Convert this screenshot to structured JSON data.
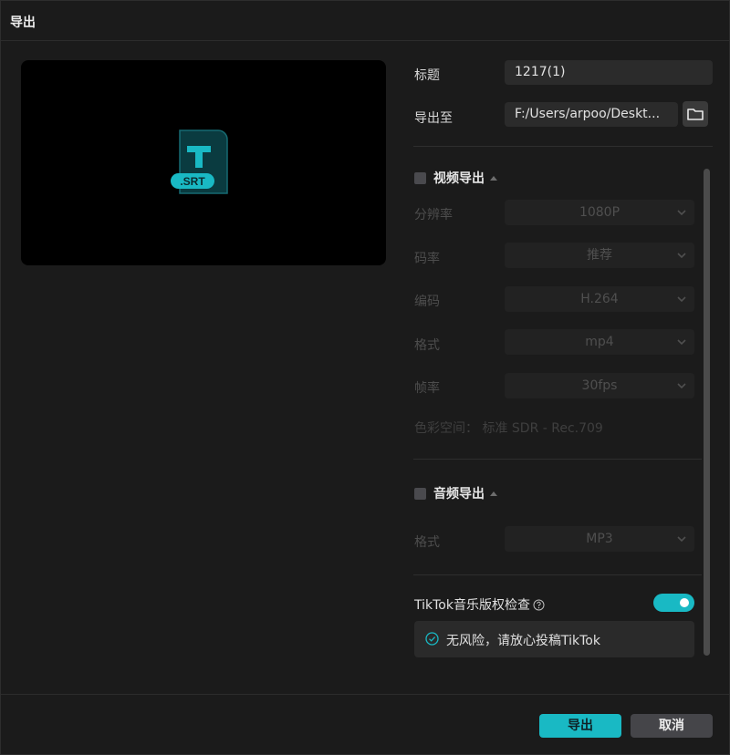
{
  "window": {
    "title": "导出"
  },
  "preview": {
    "file_badge": ".SRT",
    "icon_letter": "T"
  },
  "form": {
    "title_label": "标题",
    "title_value": "1217(1)",
    "export_to_label": "导出至",
    "export_to_value": "F:/Users/arpoo/Deskt..."
  },
  "video_export": {
    "title": "视频导出",
    "checked": false,
    "rows": [
      {
        "label": "分辨率",
        "value": "1080P"
      },
      {
        "label": "码率",
        "value": "推荐"
      },
      {
        "label": "编码",
        "value": "H.264"
      },
      {
        "label": "格式",
        "value": "mp4"
      },
      {
        "label": "帧率",
        "value": "30fps"
      }
    ],
    "color_space": "色彩空间：  标准 SDR - Rec.709"
  },
  "audio_export": {
    "title": "音频导出",
    "checked": false,
    "format_label": "格式",
    "format_value": "MP3"
  },
  "tiktok_check": {
    "label": "TikTok音乐版权检查",
    "enabled": true,
    "result": "无风险，请放心投稿TikTok"
  },
  "buttons": {
    "export": "导出",
    "cancel": "取消"
  },
  "colors": {
    "accent": "#19b9c4",
    "background": "#1b1b1b",
    "field": "#2b2b2b"
  }
}
